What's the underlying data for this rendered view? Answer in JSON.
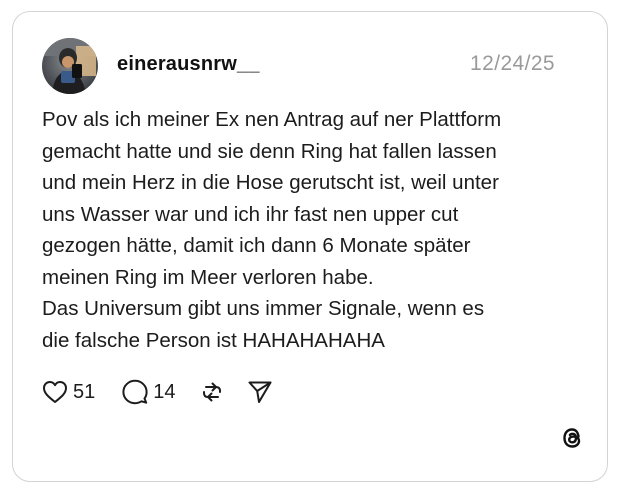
{
  "post": {
    "author": {
      "username": "einerausnrw__",
      "avatar_icon": "user-photo-avatar"
    },
    "date": "12/24/25",
    "text": "Pov als ich meiner Ex nen Antrag auf ner Plattform\ngemacht hatte und sie denn Ring hat fallen lassen\nund mein Herz in die Hose gerutscht ist, weil unter\nuns Wasser war und ich ihr fast nen upper cut\ngezogen hätte, damit ich dann 6 Monate später\nmeinen Ring im Meer verloren habe.\nDas Universum gibt uns immer Signale, wenn es\ndie falsche Person ist HAHAHAHAHA",
    "actions": {
      "likes": "51",
      "comments": "14",
      "icons": [
        "heart-icon",
        "comment-icon",
        "repost-icon",
        "share-icon"
      ]
    },
    "brand_icon": "threads-logo-icon"
  },
  "colors": {
    "border": "#d4d4d4",
    "text": "#1c1c1c",
    "date": "#9a9a9a"
  }
}
